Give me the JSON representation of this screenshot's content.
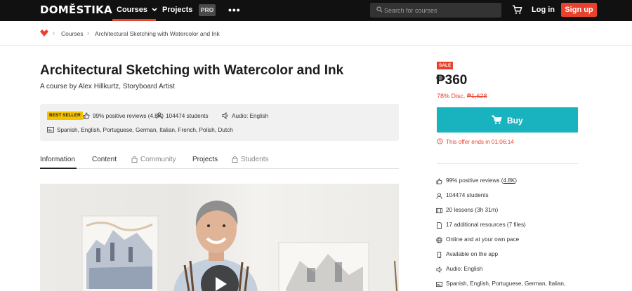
{
  "nav": {
    "logo": "DOMESTIKA",
    "courses": "Courses",
    "projects": "Projects",
    "pro": "PRO",
    "more": "•••",
    "search_placeholder": "Search for courses",
    "login": "Log in",
    "signup": "Sign up",
    "accent": "#e8412c"
  },
  "breadcrumb": {
    "items": [
      "Courses",
      "Architectural Sketching with Watercolor and Ink"
    ]
  },
  "course": {
    "title": "Architectural Sketching with Watercolor and Ink",
    "subtitle": "A course by Alex Hillkurtz, Storyboard Artist",
    "badge": "BEST SELLER",
    "reviews": "99% positive reviews (4.8K)",
    "students": "104474 students",
    "audio": "Audio: English",
    "subtitles": "Spanish, English, Portuguese, German, Italian, French, Polish, Dutch"
  },
  "tabs": [
    {
      "label": "Information",
      "active": true
    },
    {
      "label": "Content"
    },
    {
      "label": "Community",
      "locked": true
    },
    {
      "label": "Projects"
    },
    {
      "label": "Students",
      "locked": true
    }
  ],
  "pricing": {
    "sale": "SALE",
    "price": "₱360",
    "discount_prefix": "78% Disc.",
    "original": "₱1,628",
    "buy": "Buy",
    "offer": "This offer ends in 01:06:14",
    "buy_color": "#19b3bf"
  },
  "features": [
    {
      "icon": "thumbs-up-icon",
      "pre": "99% positive reviews (",
      "link": "4.8K",
      "post": ")"
    },
    {
      "icon": "user-icon",
      "text": "104474 students"
    },
    {
      "icon": "film-icon",
      "text": "20 lessons (3h 31m)"
    },
    {
      "icon": "file-icon",
      "text": "17 additional resources (7 files)"
    },
    {
      "icon": "globe-icon",
      "text": "Online and at your own pace"
    },
    {
      "icon": "phone-icon",
      "text": "Available on the app"
    },
    {
      "icon": "speaker-icon",
      "text": "Audio: English"
    },
    {
      "icon": "subtitles-icon",
      "text": "Spanish, English, Portuguese, German, Italian,"
    }
  ]
}
